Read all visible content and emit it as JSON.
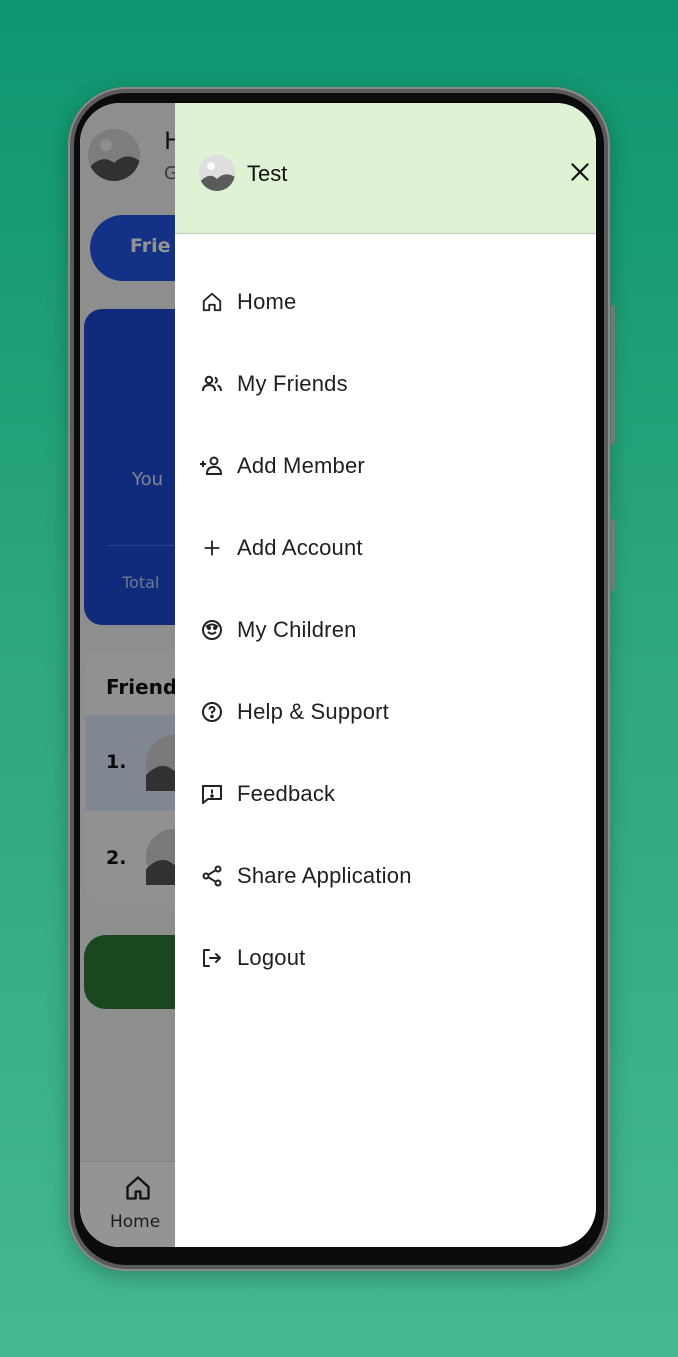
{
  "drawer": {
    "user_name": "Test",
    "close_icon": "close-icon",
    "items": [
      {
        "label": "Home",
        "icon": "home-icon"
      },
      {
        "label": "My Friends",
        "icon": "people-icon"
      },
      {
        "label": "Add Member",
        "icon": "person-add-icon"
      },
      {
        "label": "Add Account",
        "icon": "plus-icon"
      },
      {
        "label": "My Children",
        "icon": "smile-icon"
      },
      {
        "label": "Help & Support",
        "icon": "help-icon"
      },
      {
        "label": "Feedback",
        "icon": "feedback-icon"
      },
      {
        "label": "Share Application",
        "icon": "share-icon"
      },
      {
        "label": "Logout",
        "icon": "logout-icon"
      }
    ]
  },
  "background_app": {
    "greeting_fragment": "H",
    "sub_fragment": "G",
    "pill_fragment": "Frie",
    "card_you_fragment": "You",
    "card_total_fragment": "Total",
    "friends_title_fragment": "Friends",
    "row_numbers": [
      "1.",
      "2."
    ],
    "nav_home_label": "Home"
  },
  "colors": {
    "background_top": "#0e9570",
    "background_bottom": "#44b88f",
    "drawer_header": "#dff2d3",
    "accent_blue": "#2456e6",
    "accent_green": "#2c7a35"
  }
}
